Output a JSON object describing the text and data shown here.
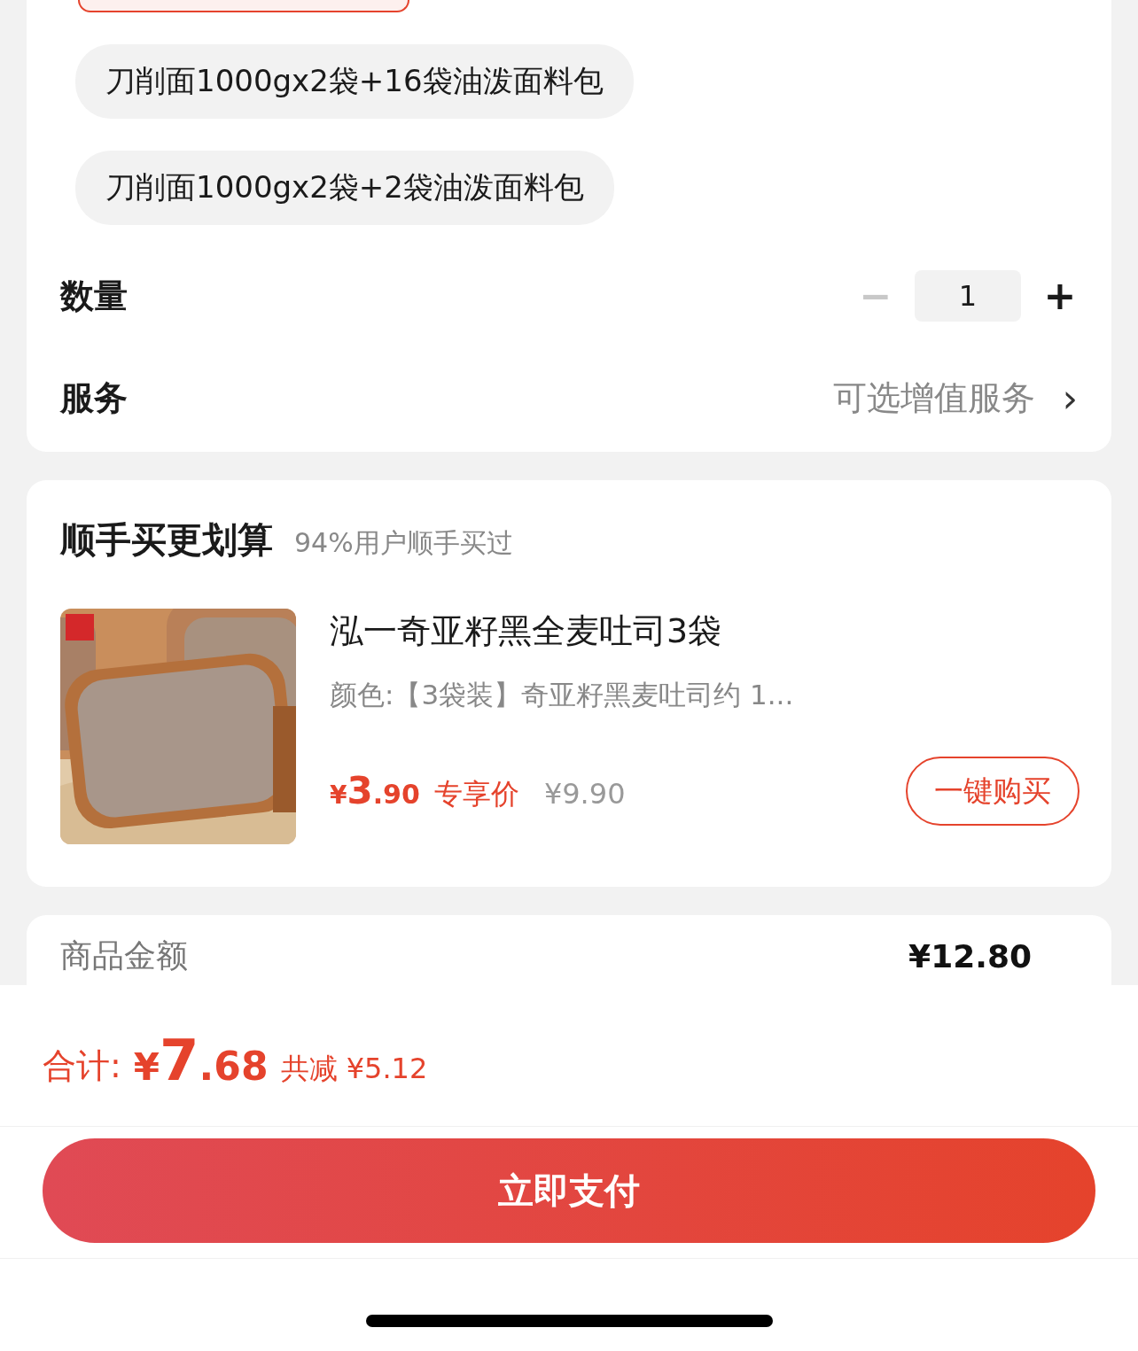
{
  "spec_options": [
    {
      "selected": true
    },
    {
      "label": "刀削面1000gx2袋+16袋油泼面料包",
      "selected": false
    },
    {
      "label": "刀削面1000gx2袋+2袋油泼面料包",
      "selected": false
    }
  ],
  "quantity": {
    "label": "数量",
    "minus": "−",
    "value": "1",
    "plus": "+",
    "minus_disabled": true
  },
  "service": {
    "label": "服务",
    "value": "可选增值服务",
    "chevron": "›"
  },
  "bundle": {
    "title": "顺手买更划算",
    "subtitle": "94%用户顺手买过",
    "product": {
      "name": "泓一奇亚籽黑全麦吐司3袋",
      "spec": "颜色:【3袋装】奇亚籽黑麦吐司约 1...",
      "price": {
        "currency": "¥",
        "integer": "3",
        "decimals": ".90"
      },
      "price_tag": "专享价",
      "original_price": "¥9.90",
      "buy_button": "一键购买"
    }
  },
  "summary": {
    "rows": [
      {
        "label": "商品金额",
        "value": "¥12.80"
      }
    ]
  },
  "footer": {
    "total_label": "合计:",
    "total": {
      "currency": "¥",
      "integer": "7",
      "decimals": ".68"
    },
    "discount": "共减 ¥5.12",
    "pay_button": "立即支付"
  }
}
